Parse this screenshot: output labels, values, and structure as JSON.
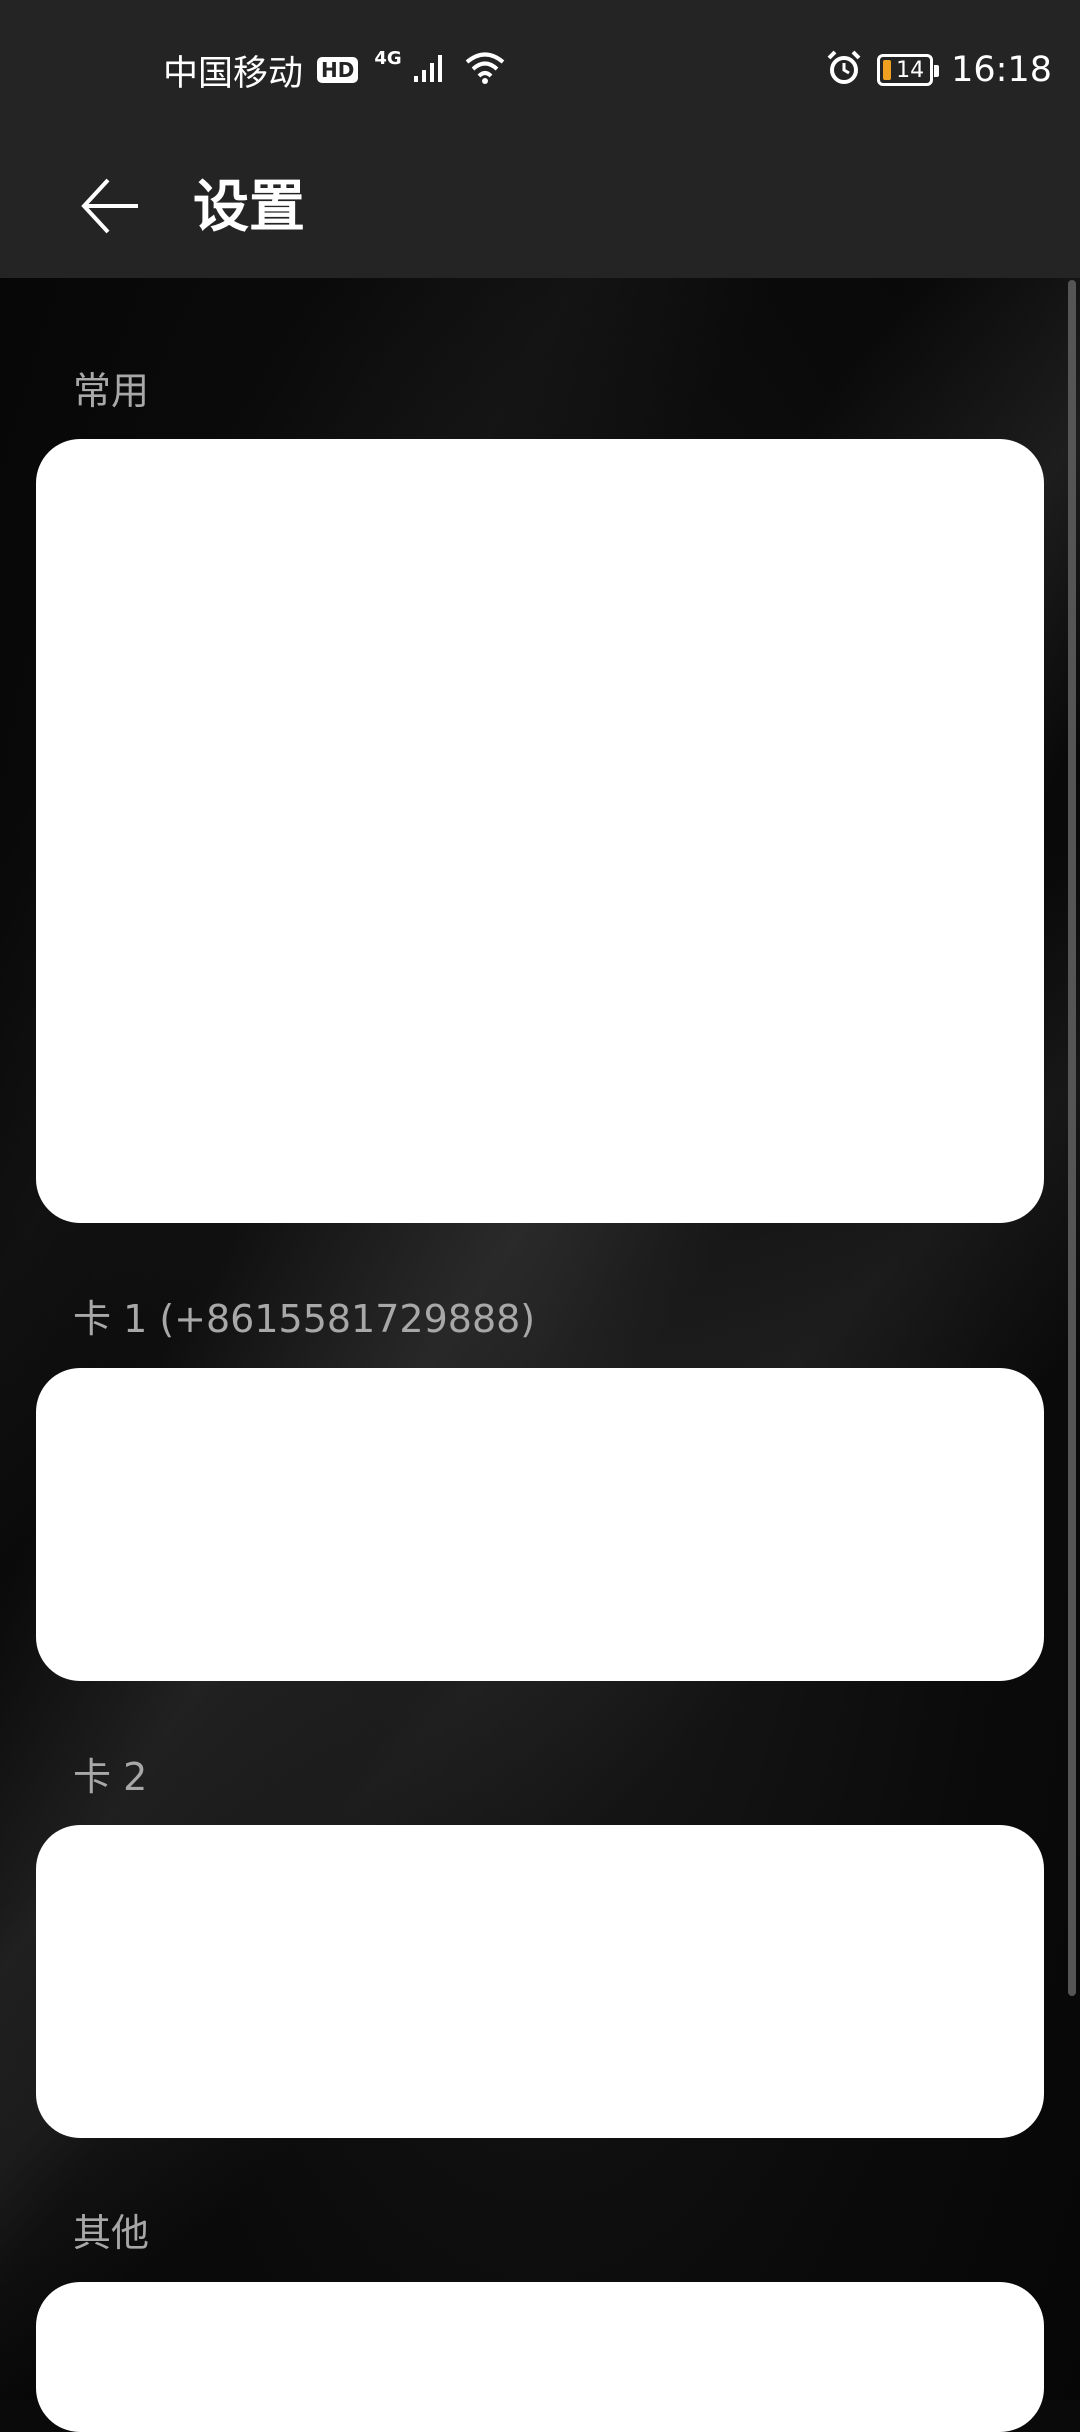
{
  "status_bar": {
    "carrier": "中国移动",
    "hd_badge": "HD",
    "network_type": "4G",
    "battery_level": "14",
    "time": "16:18",
    "icons": [
      "signal-icon",
      "wifi-icon",
      "alarm-icon",
      "battery-icon"
    ]
  },
  "app_bar": {
    "title": "设置",
    "back_icon": "arrow-left-icon"
  },
  "sections": [
    {
      "label": "常用"
    },
    {
      "label": "卡 1 (+8615581729888)"
    },
    {
      "label": "卡 2"
    },
    {
      "label": "其他"
    }
  ],
  "colors": {
    "status_bar_bg": "#242424",
    "card_bg": "#ffffff",
    "section_label": "#a8a8a8",
    "battery_accent": "#f0a020"
  }
}
